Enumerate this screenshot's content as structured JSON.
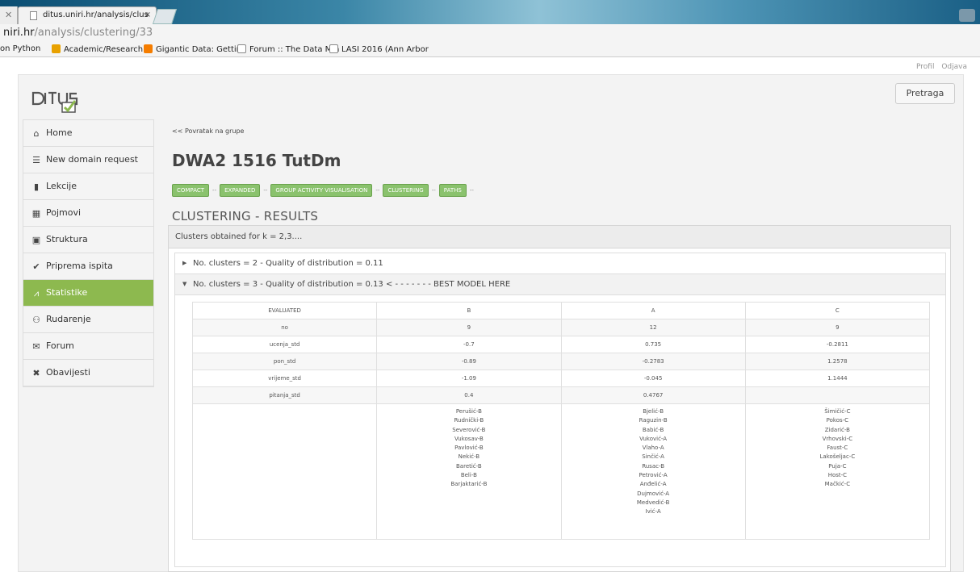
{
  "browser": {
    "tab_title": "ditus.uniri.hr/analysis/clus",
    "tab_close": "×",
    "url_host": "niri.hr",
    "url_path": "/analysis/clustering/33",
    "bookmarks": [
      {
        "label": "on Python",
        "color": ""
      },
      {
        "label": "Academic/Research p",
        "color": "#e8a100"
      },
      {
        "label": "Gigantic Data: Getting",
        "color": "#f57d00"
      },
      {
        "label": "Forum :: The Data Min",
        "color": ""
      },
      {
        "label": "LASI 2016 (Ann Arbor",
        "color": ""
      }
    ]
  },
  "top_links": {
    "profile": "Profil",
    "logout": "Odjava"
  },
  "header": {
    "search_button": "Pretraga"
  },
  "sidebar": {
    "items": [
      {
        "label": "Home",
        "icon": "home-icon",
        "glyph": "⌂"
      },
      {
        "label": "New domain request",
        "icon": "database-icon",
        "glyph": "☰"
      },
      {
        "label": "Lekcije",
        "icon": "book-icon",
        "glyph": "▮"
      },
      {
        "label": "Pojmovi",
        "icon": "grid-icon",
        "glyph": "▦"
      },
      {
        "label": "Struktura",
        "icon": "structure-icon",
        "glyph": "▣"
      },
      {
        "label": "Priprema ispita",
        "icon": "check-icon",
        "glyph": "✔"
      },
      {
        "label": "Statistike",
        "icon": "chart-icon",
        "glyph": "⩘"
      },
      {
        "label": "Rudarenje",
        "icon": "users-icon",
        "glyph": "⚇"
      },
      {
        "label": "Forum",
        "icon": "chat-icon",
        "glyph": "✉"
      },
      {
        "label": "Obavijesti",
        "icon": "announce-icon",
        "glyph": "✖"
      }
    ],
    "active_index": 6,
    "accent": "#8db94f"
  },
  "main": {
    "back_link": "<< Povratak na grupe",
    "title": "DWA2 1516 TutDm",
    "views": [
      "COMPACT",
      "EXPANDED",
      "GROUP ACTIVITY VISUALISATION",
      "CLUSTERING",
      "PATHS"
    ],
    "view_separator": "--",
    "section_title": "CLUSTERING - RESULTS",
    "box_header": "Clusters obtained for k = 2,3....",
    "accordion": [
      {
        "label": "No. clusters = 2 - Quality of distribution = 0.11",
        "expanded": false
      },
      {
        "label": "No. clusters = 3 - Quality of distribution = 0.13 < - - - - - - -  BEST MODEL HERE",
        "expanded": true
      }
    ]
  },
  "results_table": {
    "header": [
      "EVALUATED",
      "B",
      "A",
      "C"
    ],
    "rows": [
      [
        "no",
        "9",
        "12",
        "9"
      ],
      [
        "ucenja_std",
        "-0.7",
        "0.735",
        "-0.2811"
      ],
      [
        "pon_std",
        "-0.89",
        "-0.2783",
        "1.2578"
      ],
      [
        "vrijeme_std",
        "-1.09",
        "-0.045",
        "1.1444"
      ],
      [
        "pitanja_std",
        "0.4",
        "0.4767",
        ""
      ]
    ],
    "members": {
      "B": [
        "Perušić-B",
        "Rudnički-B",
        "Severović-B",
        "Vukosav-B",
        "Pavlović-B",
        "Nekić-B",
        "Baretić-B",
        "Beli-B",
        "Barjaktarić-B"
      ],
      "A": [
        "Bjelić-B",
        "Raguzin-B",
        "Babić-B",
        "Vuković-A",
        "Vlaho-A",
        "Sinčić-A",
        "Rusac-B",
        "Petrović-A",
        "Anđelić-A",
        "Dujmović-A",
        "Medvedić-B",
        "Ivić-A"
      ],
      "C": [
        "Šimičić-C",
        "Pokos-C",
        "Zidarić-B",
        "Vrhovski-C",
        "Faust-C",
        "Lakošeljac-C",
        "Puja-C",
        "Host-C",
        "Mačkić-C"
      ]
    }
  }
}
